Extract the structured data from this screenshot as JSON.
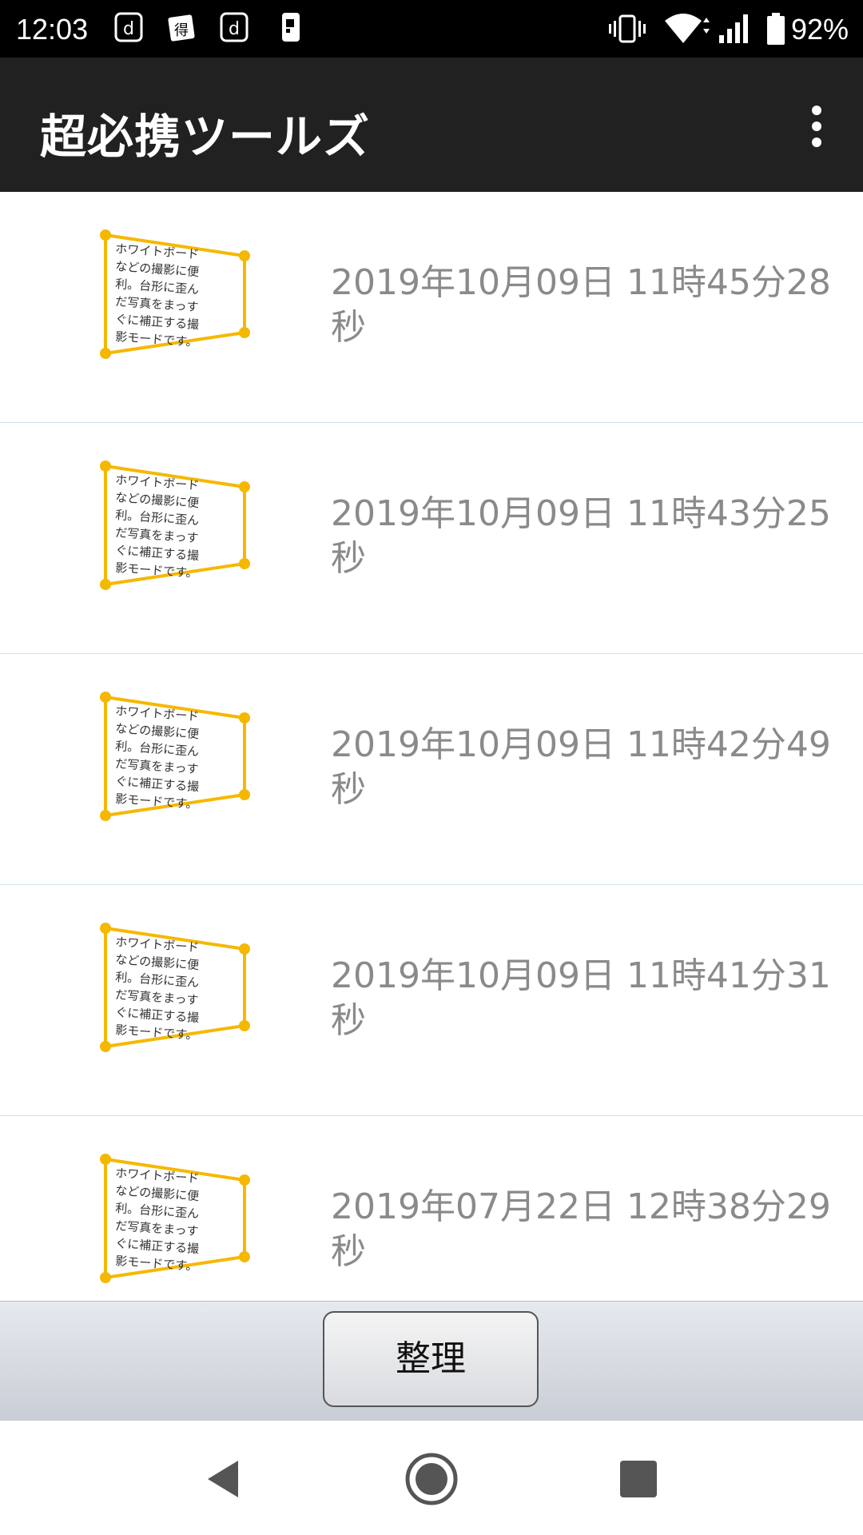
{
  "status_bar": {
    "time": "12:03",
    "notification_icons": [
      "d-account-icon",
      "tokutoku-icon",
      "d-account-icon",
      "phone-device-icon"
    ],
    "right_icons": [
      "vibrate-icon",
      "wifi-icon",
      "signal-icon",
      "battery-icon"
    ],
    "battery_percent": "92%"
  },
  "app_bar": {
    "title": "超必携ツールズ",
    "overflow_icon": "more-vert-icon"
  },
  "list": {
    "thumbnail_text": [
      "ホワイトボード",
      "などの撮影に便",
      "利。台形に歪ん",
      "だ写真をまっす",
      "ぐに補正する撮",
      "影モードです。"
    ],
    "items": [
      {
        "date": "2019年10月09日 11時45分28秒"
      },
      {
        "date": "2019年10月09日 11時43分25秒"
      },
      {
        "date": "2019年10月09日 11時42分49秒"
      },
      {
        "date": "2019年10月09日 11時41分31秒"
      },
      {
        "date": "2019年07月22日 12時38分29秒"
      }
    ]
  },
  "toolbar": {
    "organize_label": "整理"
  },
  "nav_bar": {
    "icons": [
      "back-icon",
      "home-icon",
      "recents-icon"
    ]
  },
  "colors": {
    "status_bar": "#000000",
    "app_bar": "#212121",
    "accent": "#f5b800",
    "date_text": "#8a8a8a",
    "divider": "#cfe3ea"
  }
}
